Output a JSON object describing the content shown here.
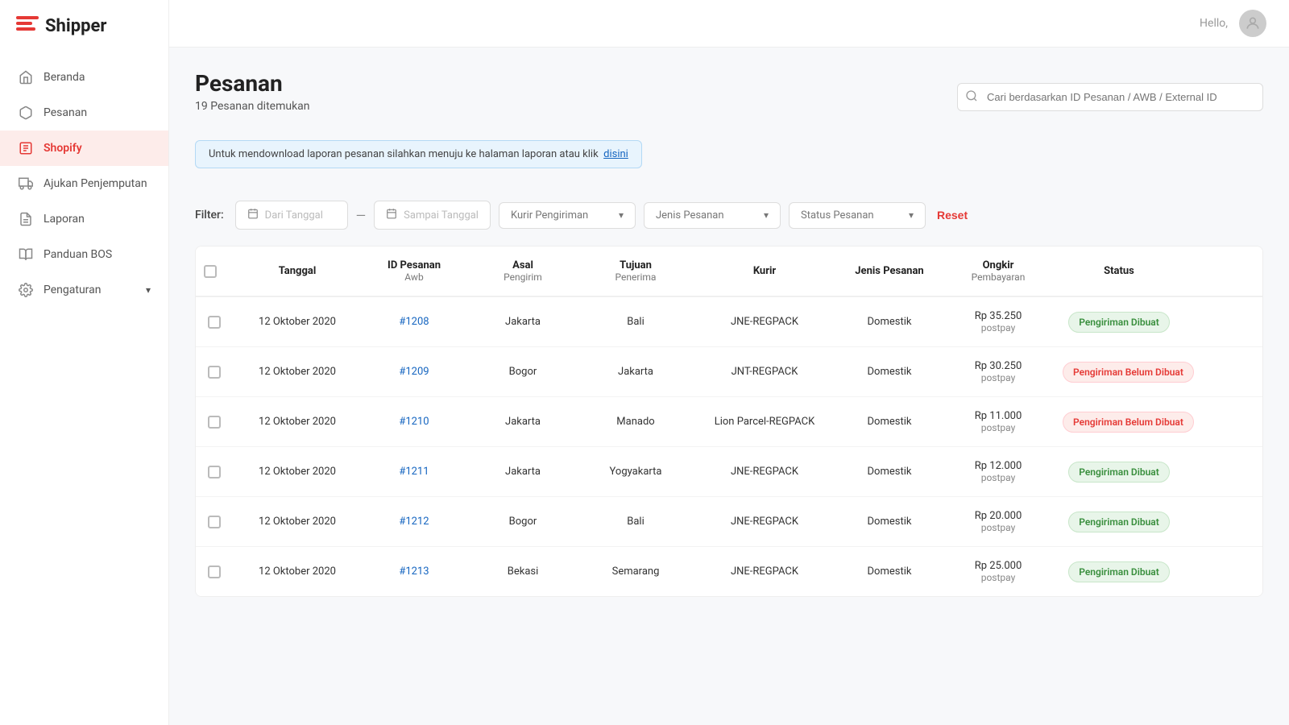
{
  "app": {
    "name": "Shipper"
  },
  "sidebar": {
    "items": [
      {
        "id": "beranda",
        "label": "Beranda",
        "icon": "home"
      },
      {
        "id": "pesanan",
        "label": "Pesanan",
        "icon": "box"
      },
      {
        "id": "shopify",
        "label": "Shopify",
        "icon": "shopify",
        "active": true
      },
      {
        "id": "ajukan-penjemputan",
        "label": "Ajukan Penjemputan",
        "icon": "truck"
      },
      {
        "id": "laporan",
        "label": "Laporan",
        "icon": "file"
      },
      {
        "id": "panduan-bos",
        "label": "Panduan BOS",
        "icon": "book"
      },
      {
        "id": "pengaturan",
        "label": "Pengaturan",
        "icon": "gear",
        "hasChevron": true
      }
    ]
  },
  "topbar": {
    "hello_label": "Hello,"
  },
  "page": {
    "title": "Pesanan",
    "subtitle": "19 Pesanan ditemukan",
    "info_banner": "Untuk mendownload laporan pesanan silahkan menuju ke halaman laporan atau klik",
    "info_link": "disini"
  },
  "search": {
    "placeholder": "Cari berdasarkan ID Pesanan / AWB / External ID"
  },
  "filter": {
    "label": "Filter:",
    "from_date_placeholder": "Dari Tanggal",
    "to_date_placeholder": "Sampai Tanggal",
    "kurir_placeholder": "Kurir Pengiriman",
    "jenis_placeholder": "Jenis Pesanan",
    "status_placeholder": "Status Pesanan",
    "reset_label": "Reset"
  },
  "table": {
    "columns": [
      {
        "label": "Tanggal",
        "sub": ""
      },
      {
        "label": "ID Pesanan",
        "sub": "Awb"
      },
      {
        "label": "Asal",
        "sub": "Pengirim"
      },
      {
        "label": "Tujuan",
        "sub": "Penerima"
      },
      {
        "label": "Kurir",
        "sub": ""
      },
      {
        "label": "Jenis Pesanan",
        "sub": ""
      },
      {
        "label": "Ongkir",
        "sub": "Pembayaran"
      },
      {
        "label": "Status",
        "sub": ""
      }
    ],
    "rows": [
      {
        "tanggal": "12 Oktober 2020",
        "id_pesanan": "#1208",
        "asal": "Jakarta",
        "tujuan": "Bali",
        "kurir": "JNE-REGPACK",
        "jenis": "Domestik",
        "ongkir": "Rp 35.250",
        "pembayaran": "postpay",
        "status": "Pengiriman Dibuat",
        "status_type": "green"
      },
      {
        "tanggal": "12 Oktober 2020",
        "id_pesanan": "#1209",
        "asal": "Bogor",
        "tujuan": "Jakarta",
        "kurir": "JNT-REGPACK",
        "jenis": "Domestik",
        "ongkir": "Rp 30.250",
        "pembayaran": "postpay",
        "status": "Pengiriman Belum Dibuat",
        "status_type": "red"
      },
      {
        "tanggal": "12 Oktober 2020",
        "id_pesanan": "#1210",
        "asal": "Jakarta",
        "tujuan": "Manado",
        "kurir": "Lion Parcel-REGPACK",
        "jenis": "Domestik",
        "ongkir": "Rp 11.000",
        "pembayaran": "postpay",
        "status": "Pengiriman Belum Dibuat",
        "status_type": "red"
      },
      {
        "tanggal": "12 Oktober 2020",
        "id_pesanan": "#1211",
        "asal": "Jakarta",
        "tujuan": "Yogyakarta",
        "kurir": "JNE-REGPACK",
        "jenis": "Domestik",
        "ongkir": "Rp 12.000",
        "pembayaran": "postpay",
        "status": "Pengiriman Dibuat",
        "status_type": "green"
      },
      {
        "tanggal": "12 Oktober 2020",
        "id_pesanan": "#1212",
        "asal": "Bogor",
        "tujuan": "Bali",
        "kurir": "JNE-REGPACK",
        "jenis": "Domestik",
        "ongkir": "Rp 20.000",
        "pembayaran": "postpay",
        "status": "Pengiriman Dibuat",
        "status_type": "green"
      },
      {
        "tanggal": "12 Oktober 2020",
        "id_pesanan": "#1213",
        "asal": "Bekasi",
        "tujuan": "Semarang",
        "kurir": "JNE-REGPACK",
        "jenis": "Domestik",
        "ongkir": "Rp 25.000",
        "pembayaran": "postpay",
        "status": "Pengiriman Dibuat",
        "status_type": "green"
      }
    ]
  }
}
